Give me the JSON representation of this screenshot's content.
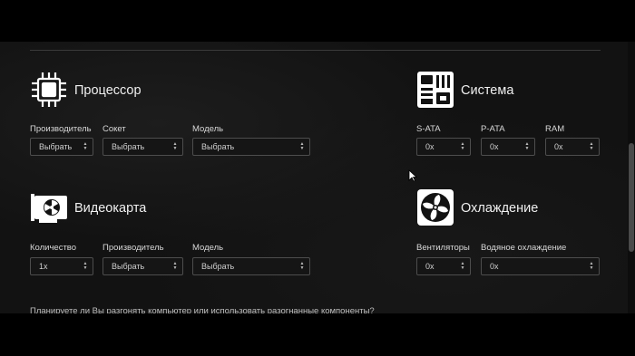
{
  "processor": {
    "title": "Процессор",
    "icon": "cpu-icon",
    "fields": [
      {
        "label": "Производитель",
        "value": "Выбрать"
      },
      {
        "label": "Сокет",
        "value": "Выбрать"
      },
      {
        "label": "Модель",
        "value": "Выбрать"
      }
    ]
  },
  "system": {
    "title": "Система",
    "icon": "motherboard-icon",
    "fields": [
      {
        "label": "S-ATA",
        "value": "0x"
      },
      {
        "label": "P-ATA",
        "value": "0x"
      },
      {
        "label": "RAM",
        "value": "0x"
      }
    ]
  },
  "gpu": {
    "title": "Видеокарта",
    "icon": "graphics-card-icon",
    "fields": [
      {
        "label": "Количество",
        "value": "1x"
      },
      {
        "label": "Производитель",
        "value": "Выбрать"
      },
      {
        "label": "Модель",
        "value": "Выбрать"
      }
    ]
  },
  "cooling": {
    "title": "Охлаждение",
    "icon": "fan-icon",
    "fields": [
      {
        "label": "Вентиляторы",
        "value": "0x"
      },
      {
        "label": "Водяное охлаждение",
        "value": "0x"
      }
    ]
  },
  "overclock_question": "Планируете ли Вы разгонять компьютер или использовать разогнанные компоненты?",
  "colors": {
    "background": "#121212",
    "select_border": "#4d4d4d",
    "text": "#e6e6e6"
  }
}
